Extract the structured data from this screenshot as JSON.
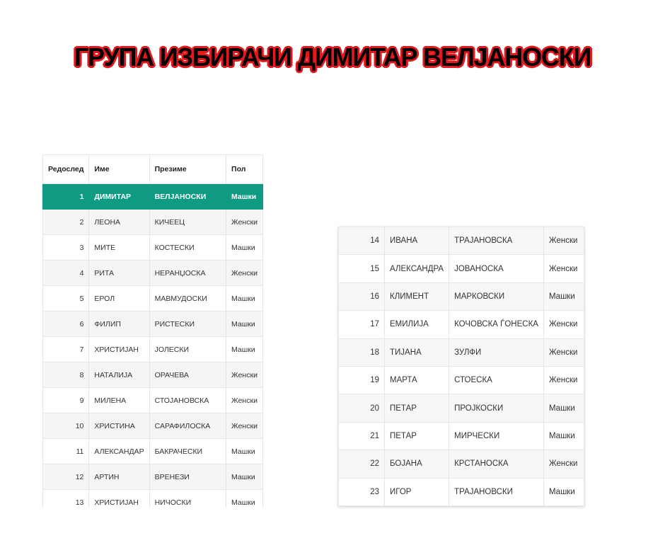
{
  "title": "ГРУПА ИЗБИРАЧИ ДИМИТАР ВЕЛЈАНОСКИ",
  "table1": {
    "headers": [
      "Редослед",
      "Име",
      "Презиме",
      "Пол"
    ],
    "rows": [
      [
        "1",
        "ДИМИТАР",
        "ВЕЛЈАНОСКИ",
        "Машки"
      ],
      [
        "2",
        "ЛЕОНА",
        "КИЧЕЕЦ",
        "Женски"
      ],
      [
        "3",
        "МИТЕ",
        "КОСТЕСКИ",
        "Машки"
      ],
      [
        "4",
        "РИТА",
        "НЕРАНЏОСКА",
        "Женски"
      ],
      [
        "5",
        "ЕРОЛ",
        "МАВМУДОСКИ",
        "Машки"
      ],
      [
        "6",
        "ФИЛИП",
        "РИСТЕСКИ",
        "Машки"
      ],
      [
        "7",
        "ХРИСТИЈАН",
        "ЈОЛЕСКИ",
        "Машки"
      ],
      [
        "8",
        "НАТАЛИЈА",
        "ОРАЧЕВА",
        "Женски"
      ],
      [
        "9",
        "МИЛЕНА",
        "СТОЈАНОВСКА",
        "Женски"
      ],
      [
        "10",
        "ХРИСТИНА",
        "САРАФИЛОСКА",
        "Женски"
      ],
      [
        "11",
        "АЛЕКСАНДАР",
        "БАКРАЧЕСКИ",
        "Машки"
      ],
      [
        "12",
        "АРТИН",
        "ВРЕНЕЗИ",
        "Машки"
      ],
      [
        "13",
        "ХРИСТИЈАН",
        "НИЧОСКИ",
        "Машки"
      ]
    ]
  },
  "table2": {
    "rows": [
      [
        "14",
        "ИВАНА",
        "ТРАЈАНОВСКА",
        "Женски"
      ],
      [
        "15",
        "АЛЕКСАНДРА",
        "ЈОВАНОСКА",
        "Женски"
      ],
      [
        "16",
        "КЛИМЕНТ",
        "МАРКОВСКИ",
        "Машки"
      ],
      [
        "17",
        "ЕМИЛИЈА",
        "КОЧОВСКА ЃОНЕСКА",
        "Женски"
      ],
      [
        "18",
        "ТИЈАНА",
        "ЗУЛФИ",
        "Женски"
      ],
      [
        "19",
        "МАРТА",
        "СТОЕСКА",
        "Женски"
      ],
      [
        "20",
        "ПЕТАР",
        "ПРОЈКОСКИ",
        "Машки"
      ],
      [
        "21",
        "ПЕТАР",
        "МИРЧЕСКИ",
        "Машки"
      ],
      [
        "22",
        "БОЈАНА",
        "КРСТАНОСКА",
        "Женски"
      ],
      [
        "23",
        "ИГОР",
        "ТРАЈАНОВСКИ",
        "Машки"
      ]
    ]
  },
  "colors": {
    "title_text": "#000000",
    "title_outline": "#e3191e",
    "highlight_row": "#0f9a84",
    "stripe": "#f5f5f5",
    "border": "#e6e6e6"
  }
}
